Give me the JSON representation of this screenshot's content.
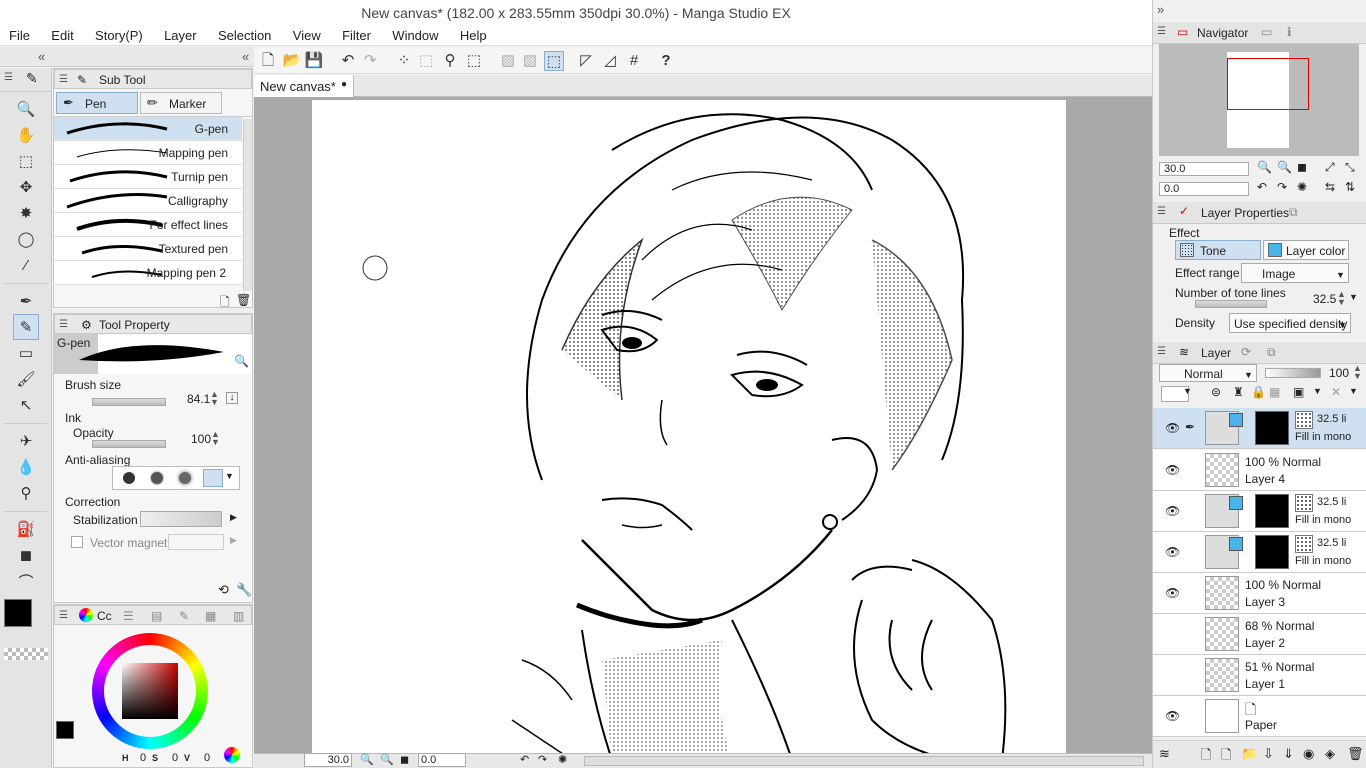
{
  "window": {
    "title": "New canvas* (182.00 x 283.55mm 350dpi 30.0%)  - Manga Studio EX"
  },
  "menu": [
    "File",
    "Edit",
    "Story(P)",
    "Layer",
    "Selection",
    "View",
    "Filter",
    "Window",
    "Help"
  ],
  "document": {
    "tab_label": "New canvas*",
    "zoom": "30.0",
    "rotation": "0.0"
  },
  "subtool": {
    "panel_title": "Sub Tool",
    "tabs": [
      "Pen",
      "Marker"
    ],
    "brushes": [
      "G-pen",
      "Mapping pen",
      "Turnip pen",
      "Calligraphy",
      "For effect lines",
      "Textured pen",
      "Mapping pen 2"
    ]
  },
  "toolprop": {
    "panel_title": "Tool Property",
    "brush_name": "G-pen",
    "brush_size_label": "Brush size",
    "brush_size_value": "84.1",
    "ink_label": "Ink",
    "opacity_label": "Opacity",
    "opacity_value": "100",
    "antialias_label": "Anti-aliasing",
    "correction_label": "Correction",
    "stabilization_label": "Stabilization",
    "vector_magnet_label": "Vector magnet"
  },
  "color": {
    "panel_tab": "Cc",
    "main_color": "#000000",
    "sub_color": "#2e7aa0",
    "h_label": "H",
    "h_value": "0",
    "s_label": "S",
    "s_value": "0",
    "v_label": "V",
    "v_value": "0"
  },
  "navigator": {
    "title": "Navigator",
    "zoom": "30.0",
    "rotation": "0.0"
  },
  "layer_properties": {
    "title": "Layer Properties",
    "effect_label": "Effect",
    "tone_label": "Tone",
    "layer_color_label": "Layer color",
    "effect_range_label": "Effect range",
    "effect_range_value": "Image",
    "tone_lines_label": "Number of tone lines",
    "tone_lines_value": "32.5",
    "density_label": "Density",
    "density_value": "Use specified density"
  },
  "layer_panel": {
    "title": "Layer",
    "blend_mode": "Normal",
    "opacity": "100",
    "layers": [
      {
        "line1": "32.5 li",
        "line2": "Fill in mono",
        "visible": true,
        "selected": true,
        "kind": "tone"
      },
      {
        "line1": "100 %   Normal",
        "line2": "Layer 4",
        "visible": true,
        "selected": false,
        "kind": "raster"
      },
      {
        "line1": "32.5 li",
        "line2": "Fill in mono",
        "visible": true,
        "selected": false,
        "kind": "tone"
      },
      {
        "line1": "32.5 li",
        "line2": "Fill in mono",
        "visible": true,
        "selected": false,
        "kind": "tone"
      },
      {
        "line1": "100 %   Normal",
        "line2": "Layer 3",
        "visible": true,
        "selected": false,
        "kind": "raster"
      },
      {
        "line1": "68 %   Normal",
        "line2": "Layer 2",
        "visible": false,
        "selected": false,
        "kind": "raster"
      },
      {
        "line1": "51 %   Normal",
        "line2": "Layer 1",
        "visible": false,
        "selected": false,
        "kind": "raster"
      },
      {
        "line1": "",
        "line2": "Paper",
        "visible": true,
        "selected": false,
        "kind": "paper"
      }
    ]
  }
}
